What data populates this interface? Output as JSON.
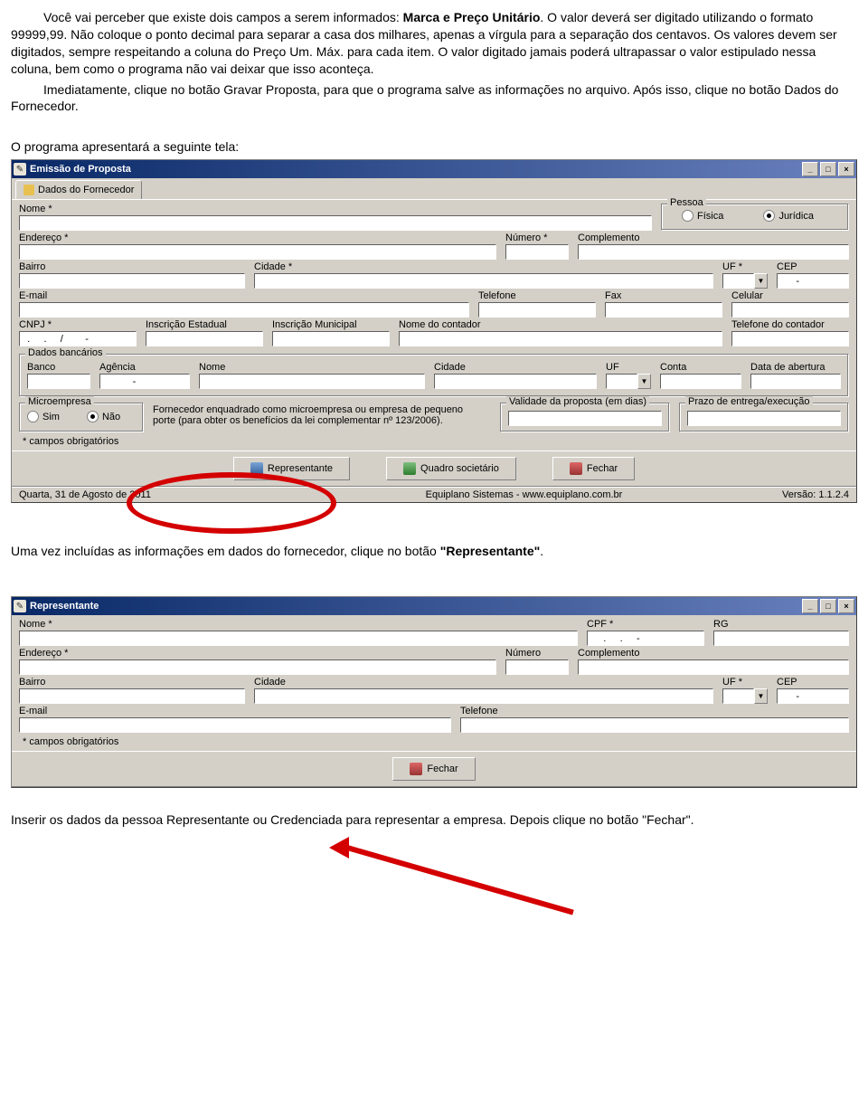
{
  "instructions": {
    "p1a": "Você vai perceber que existe dois campos a serem informados: ",
    "p1b": "Marca e Preço Unitário",
    "p1c": ". O valor deverá ser digitado utilizando o formato 99999,99. Não coloque o ponto decimal para separar a casa dos milhares, apenas a vírgula para a separação dos centavos. Os valores devem ser digitados, sempre respeitando a coluna do Preço Um. Máx. para cada item. O valor digitado jamais poderá ultrapassar o valor estipulado nessa coluna, bem como o programa não vai deixar que isso aconteça.",
    "p2": "Imediatamente, clique no botão Gravar Proposta, para que o programa salve as informações no arquivo. Após isso, clique no botão Dados do Fornecedor.",
    "p3": "O programa apresentará a seguinte tela:",
    "p4a": "Uma vez incluídas as informações em dados do fornecedor, clique no botão ",
    "p4b": "\"Representante\"",
    "p4c": ".",
    "p5": "Inserir os dados da pessoa Representante ou Credenciada para representar a empresa. Depois clique no botão \"Fechar\"."
  },
  "win1": {
    "title": "Emissão de Proposta",
    "tab": "Dados do Fornecedor",
    "labels": {
      "nome": "Nome *",
      "pessoa": "Pessoa",
      "fisica": "Física",
      "juridica": "Jurídica",
      "endereco": "Endereço *",
      "numero": "Número *",
      "complemento": "Complemento",
      "bairro": "Bairro",
      "cidade": "Cidade *",
      "uf": "UF *",
      "cep": "CEP",
      "email": "E-mail",
      "telefone": "Telefone",
      "fax": "Fax",
      "celular": "Celular",
      "cnpj": "CNPJ *",
      "insc_est": "Inscrição Estadual",
      "insc_mun": "Inscrição Municipal",
      "nome_contador": "Nome do contador",
      "tel_contador": "Telefone do contador",
      "dados_banc": "Dados bancários",
      "banco": "Banco",
      "agencia": "Agência",
      "banconome": "Nome",
      "bancocidade": "Cidade",
      "bancouf": "UF",
      "conta": "Conta",
      "data_abertura": "Data de abertura",
      "micro": "Microempresa",
      "sim": "Sim",
      "nao": "Não",
      "micro_txt": "Fornecedor enquadrado como microempresa ou empresa de pequeno porte (para obter os benefícios da lei complementar nº 123/2006).",
      "validade": "Validade da proposta (em dias)",
      "prazo": "Prazo de entrega/execução",
      "obrig": "* campos obrigatórios",
      "cnpj_mask": "  .     .     /        -",
      "cep_mask": "      -",
      "agencia_mask": "           -"
    },
    "buttons": {
      "representante": "Representante",
      "quadro": "Quadro societário",
      "fechar": "Fechar"
    },
    "status": {
      "date": "Quarta, 31 de Agosto de 2011",
      "company": "Equiplano Sistemas - www.equiplano.com.br",
      "version": "Versão: 1.1.2.4"
    },
    "winbtns": {
      "min": "_",
      "max": "□",
      "close": "×"
    }
  },
  "win2": {
    "title": "Representante",
    "labels": {
      "nome": "Nome *",
      "cpf": "CPF *",
      "rg": "RG",
      "endereco": "Endereço *",
      "numero": "Número",
      "complemento": "Complemento",
      "bairro": "Bairro",
      "cidade": "Cidade",
      "uf": "UF *",
      "cep": "CEP",
      "email": "E-mail",
      "telefone": "Telefone",
      "obrig": "* campos obrigatórios",
      "cpf_mask": "     .     .     -",
      "cep_mask": "      -"
    },
    "buttons": {
      "fechar": "Fechar"
    },
    "winbtns": {
      "min": "_",
      "max": "□",
      "close": "×"
    }
  }
}
